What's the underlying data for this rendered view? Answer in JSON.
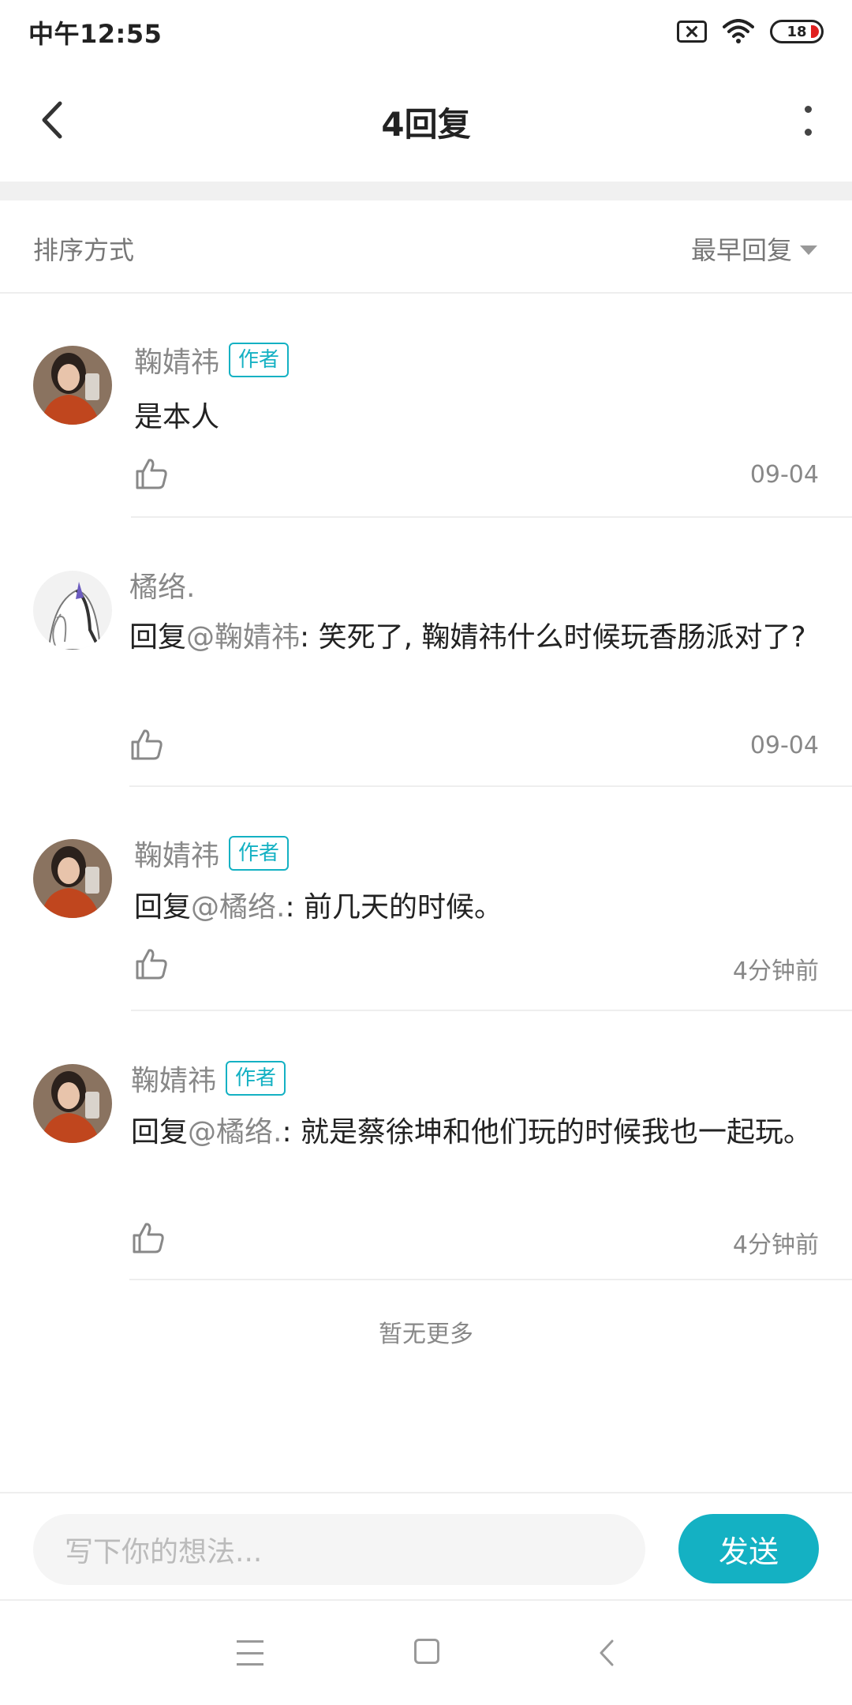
{
  "status_bar": {
    "time": "中午12:55",
    "battery": "18"
  },
  "header": {
    "title": "4回复"
  },
  "sort": {
    "label": "排序方式",
    "value": "最早回复"
  },
  "comments": [
    {
      "user": "鞠婧祎",
      "badge": "作者",
      "text": "是本人",
      "mention": "",
      "time": "09-04"
    },
    {
      "user": "橘络.",
      "badge": "",
      "prefix": "回复",
      "mention": "@鞠婧祎",
      "text": ": 笑死了, 鞠婧祎什么时候玩香肠派对了?",
      "time": "09-04"
    },
    {
      "user": "鞠婧祎",
      "badge": "作者",
      "prefix": "回复",
      "mention": "@橘络.",
      "text": ": 前几天的时候。",
      "time": "4分钟前"
    },
    {
      "user": "鞠婧祎",
      "badge": "作者",
      "prefix": "回复",
      "mention": "@橘络.",
      "text": ": 就是蔡徐坤和他们玩的时候我也一起玩。",
      "time": "4分钟前"
    }
  ],
  "footer_note": "暂无更多",
  "input": {
    "placeholder": "写下你的想法...",
    "send_label": "发送"
  },
  "colors": {
    "accent": "#14b1c3",
    "meta": "#888888",
    "text": "#222222"
  }
}
